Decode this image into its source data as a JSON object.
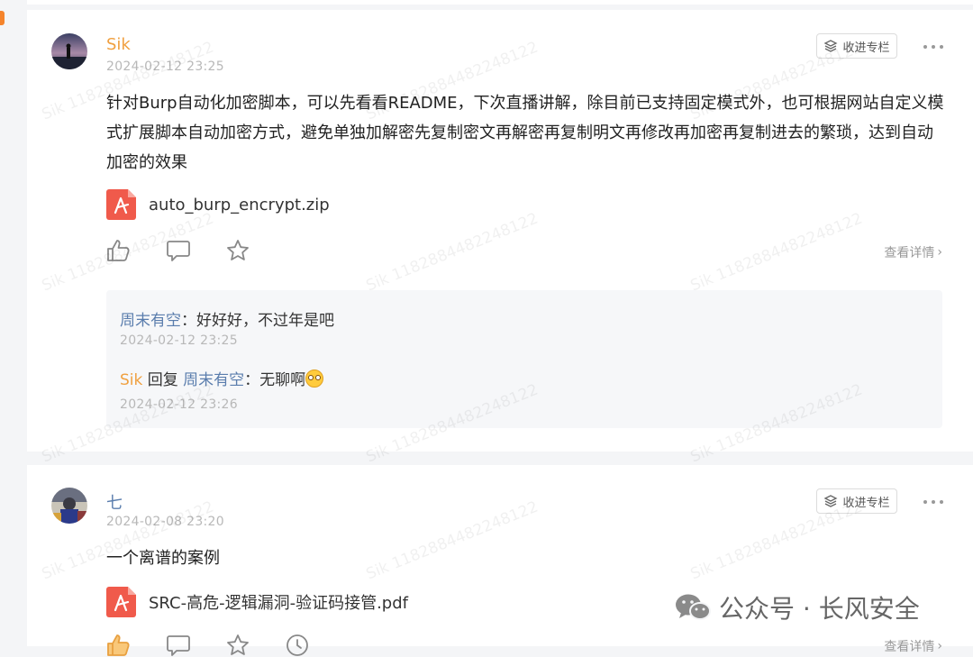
{
  "watermark_text": "Sik 1182884482248122",
  "posts": [
    {
      "author": "Sik",
      "time": "2024-02-12 23:25",
      "collect_label": "收进专栏",
      "text": "针对Burp自动化加密脚本，可以先看看README，下次直播讲解，除目前已支持固定模式外，也可根据网站自定义模式扩展脚本自动加密方式，避免单独加解密先复制密文再解密再复制明文再修改再加密再复制进去的繁琐，达到自动加密的效果",
      "attachment": "auto_burp_encrypt.zip",
      "details_label": "查看详情",
      "comments": [
        {
          "name": "周末有空",
          "separator": "：",
          "text": "好好好，不过年是吧",
          "time": "2024-02-12 23:25"
        },
        {
          "name": "Sik",
          "reply_word": "回复",
          "reply_to": "周末有空",
          "separator": "：",
          "text": "无聊啊",
          "emoji": "dizzy-face-emoji",
          "time": "2024-02-12 23:26"
        }
      ]
    },
    {
      "author": "七",
      "time": "2024-02-08 23:20",
      "collect_label": "收进专栏",
      "text": "一个离谱的案例",
      "attachment": "SRC-高危-逻辑漏洞-验证码接管.pdf",
      "details_label": "查看详情"
    }
  ],
  "brand": {
    "name": "公众号 · 长风安全",
    "icon": "wechat-icon"
  },
  "colors": {
    "author_orange": "#f0a040",
    "author_blue": "#5a7dad",
    "pdf_red": "#f05a4b",
    "accent": "#f5842c"
  }
}
